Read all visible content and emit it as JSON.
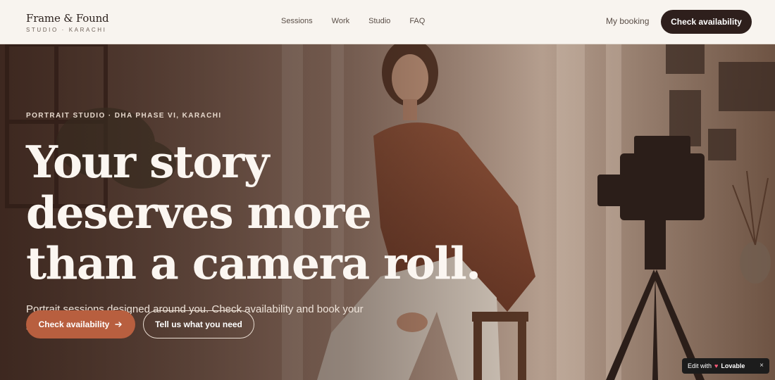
{
  "header": {
    "brand_name": "Frame & Found",
    "brand_sub": "STUDIO · KARACHI",
    "nav": [
      "Sessions",
      "Work",
      "Studio",
      "FAQ"
    ],
    "my_booking": "My booking",
    "cta": "Check availability"
  },
  "hero": {
    "eyebrow": "PORTRAIT STUDIO · DHA PHASE VI, KARACHI",
    "headline_lines": [
      "Your story",
      "deserves more",
      "than a camera roll."
    ],
    "subtext": "Portrait sessions designed around you. Check availability and book your session in minutes.",
    "primary_cta": "Check availability",
    "primary_cta_icon": "arrow-right-icon",
    "secondary_cta": "Tell us what you need"
  },
  "badge": {
    "prefix": "Edit with",
    "brand": "Lovable",
    "close": "×"
  },
  "colors": {
    "accent": "#b85f3f",
    "dark_button": "#2e1f1c",
    "header_bg": "#f8f4ef"
  }
}
